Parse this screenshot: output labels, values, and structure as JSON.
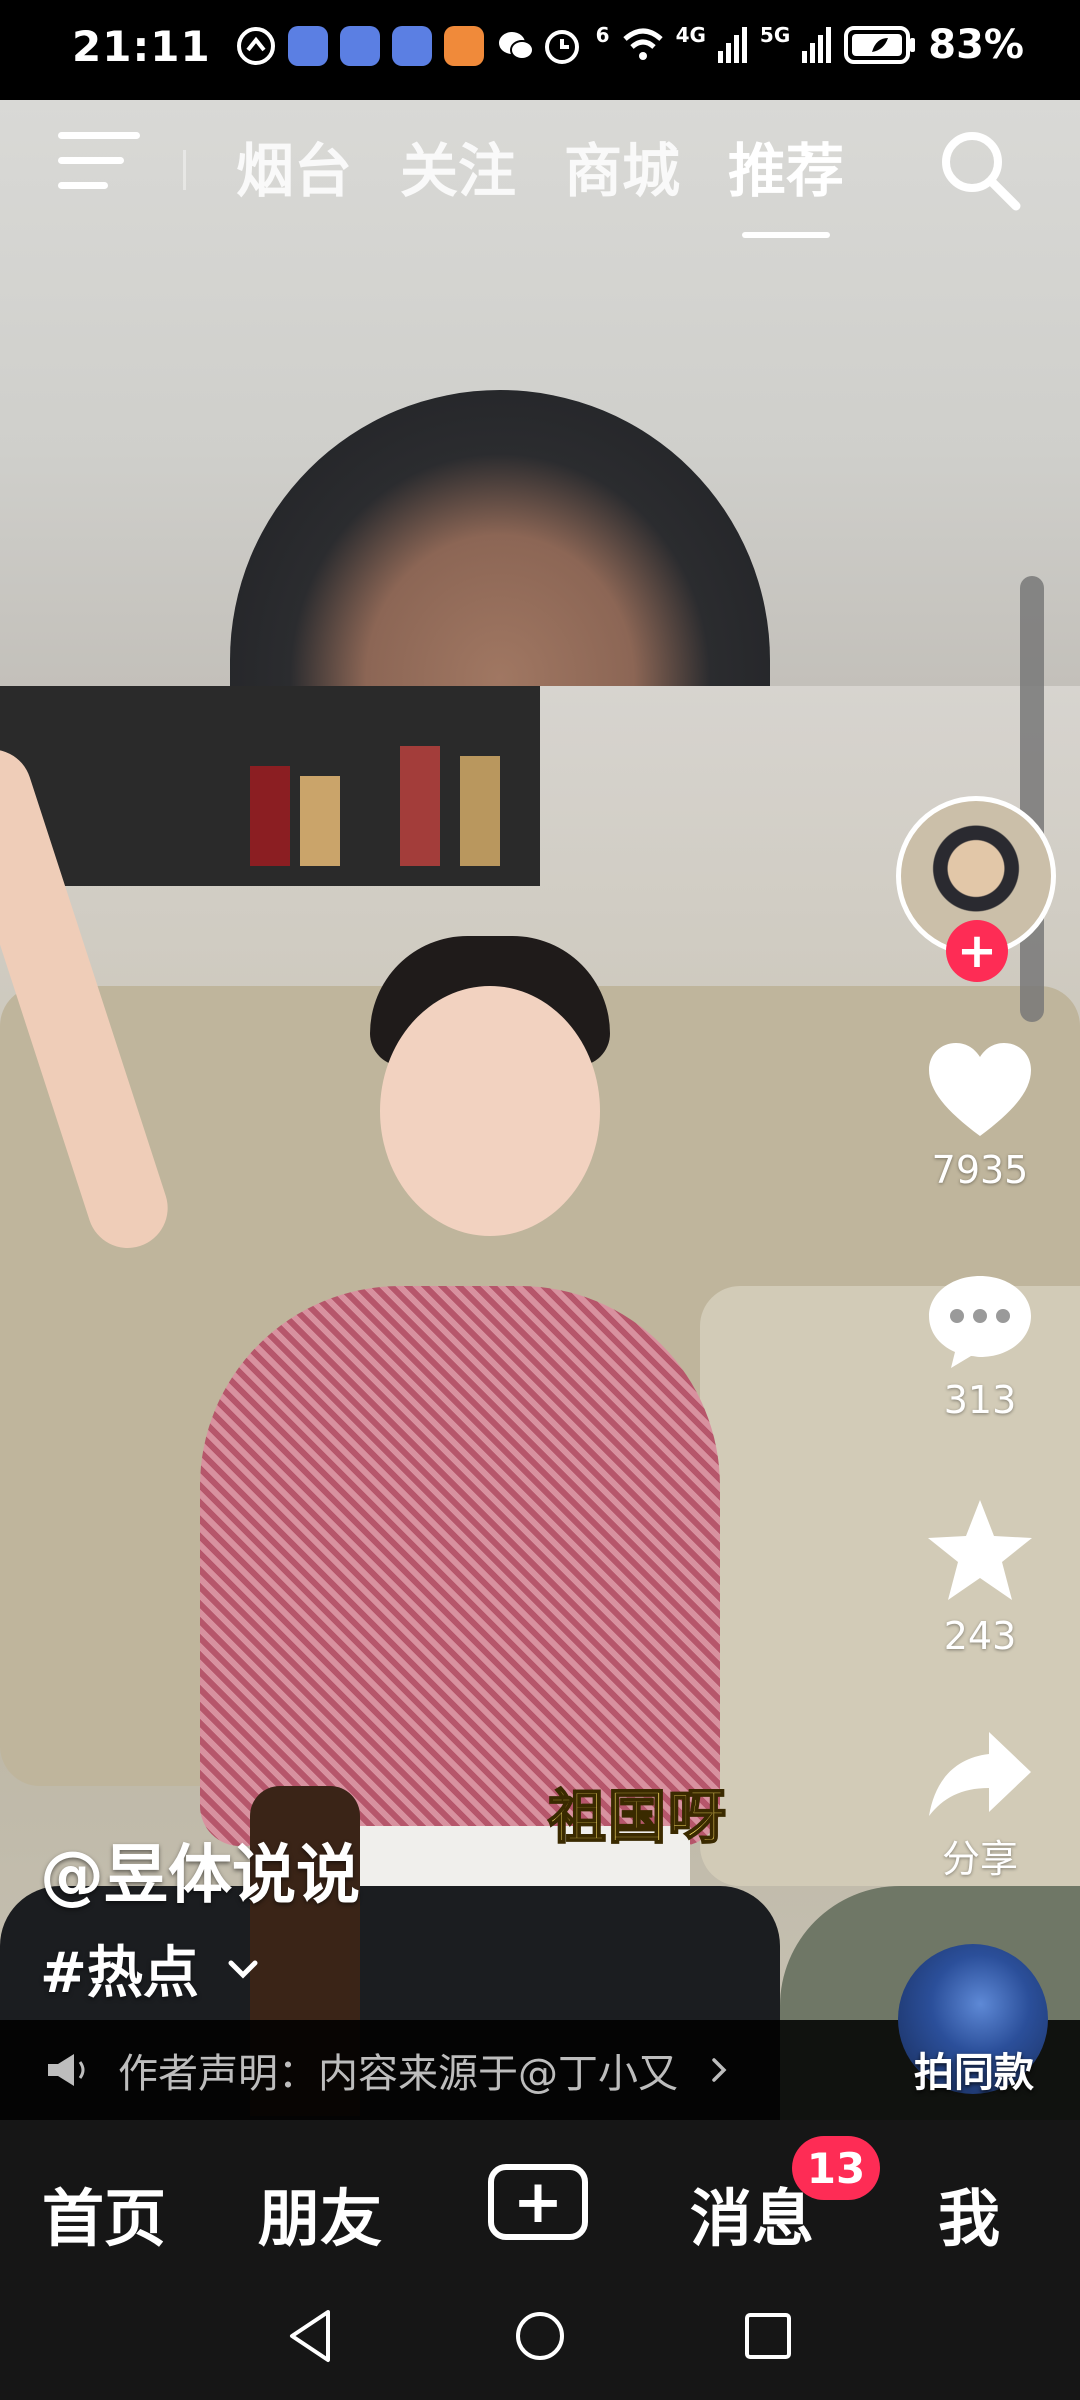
{
  "status_bar": {
    "time": "21:11",
    "signal_4g": "4G",
    "signal_5g": "5G",
    "wifi_sup": "6",
    "battery": "83%"
  },
  "top_nav": {
    "tabs": [
      {
        "label": "烟台",
        "active": false
      },
      {
        "label": "关注",
        "active": false
      },
      {
        "label": "商城",
        "active": false
      },
      {
        "label": "推荐",
        "active": true
      }
    ]
  },
  "video": {
    "subtitle": "祖国呀",
    "author": "@昱体说说",
    "hashtag": "#热点"
  },
  "actions": {
    "likes": "7935",
    "comments": "313",
    "favorites": "243",
    "share_label": "分享",
    "make_same_label": "拍同款"
  },
  "statement": {
    "text": "作者声明：内容来源于@丁小又"
  },
  "bottom_nav": {
    "home": "首页",
    "friends": "朋友",
    "messages": "消息",
    "messages_badge": "13",
    "me": "我"
  },
  "colors": {
    "accent": "#fe2c55",
    "subtitle": "#ffe46b"
  }
}
